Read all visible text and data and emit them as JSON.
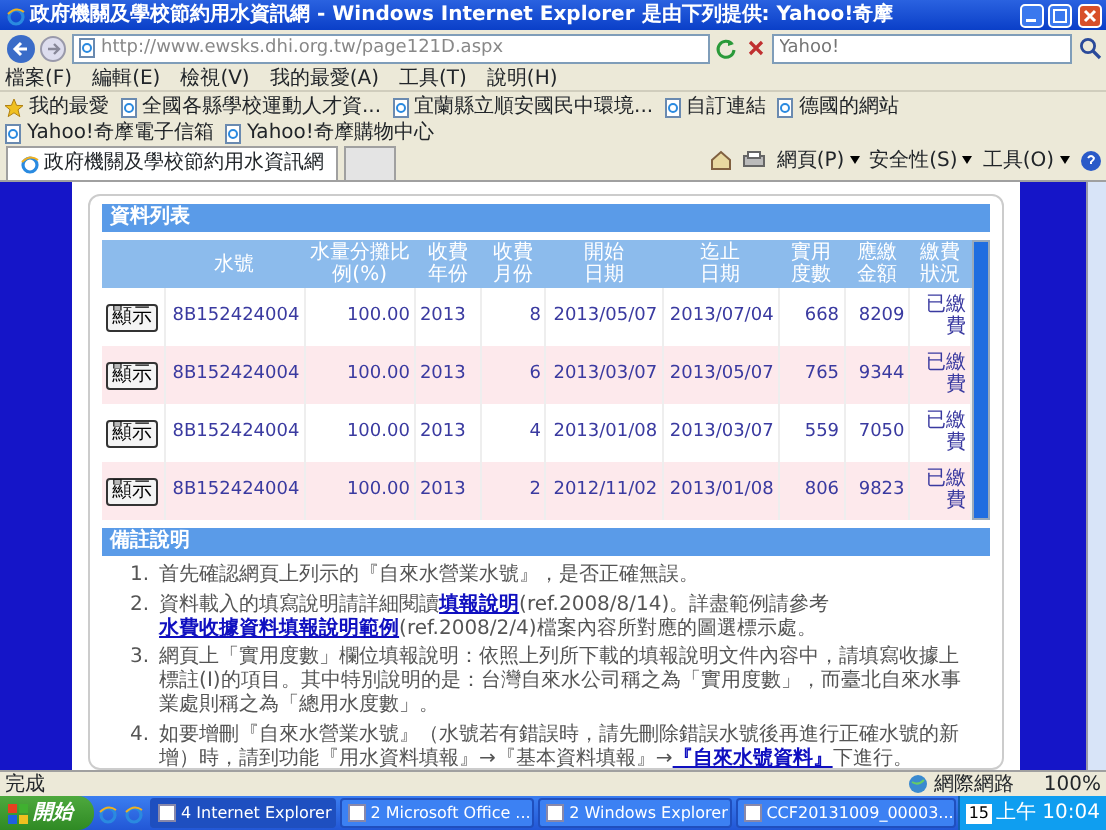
{
  "window": {
    "title": "政府機關及學校節約用水資訊網 - Windows Internet Explorer 是由下列提供: Yahoo!奇摩"
  },
  "address_bar": {
    "url": "http://www.ewsks.dhi.org.tw/page121D.aspx",
    "search_placeholder": "Yahoo!"
  },
  "menu": [
    "檔案(F)",
    "編輯(E)",
    "檢視(V)",
    "我的最愛(A)",
    "工具(T)",
    "說明(H)"
  ],
  "favorites_bar": {
    "label": "我的最愛",
    "links": [
      "全國各縣學校運動人才資...",
      "宜蘭縣立順安國民中環境...",
      "自訂連結",
      "德國的網站",
      "Yahoo!奇摩電子信箱",
      "Yahoo!奇摩購物中心"
    ]
  },
  "tabs": [
    {
      "label": "政府機關及學校節約用水資訊網",
      "selected": true
    }
  ],
  "command_bar": [
    "網頁(P)",
    "安全性(S)",
    "工具(O)"
  ],
  "data_list": {
    "title": "資料列表",
    "columns": [
      "",
      "水號",
      "水量分攤比例(%)",
      "收費年份",
      "收費月份",
      "開始日期",
      "迄止日期",
      "實用度數",
      "應繳金額",
      "繳費狀況"
    ],
    "rows": [
      {
        "cells": [
          "顯示",
          "8B152424004",
          "100.00",
          "2013",
          "8",
          "2013/05/07",
          "2013/07/04",
          "668",
          "8209",
          "已繳費"
        ]
      },
      {
        "cells": [
          "顯示",
          "8B152424004",
          "100.00",
          "2013",
          "6",
          "2013/03/07",
          "2013/05/07",
          "765",
          "9344",
          "已繳費"
        ]
      },
      {
        "cells": [
          "顯示",
          "8B152424004",
          "100.00",
          "2013",
          "4",
          "2013/01/08",
          "2013/03/07",
          "559",
          "7050",
          "已繳費"
        ]
      },
      {
        "cells": [
          "顯示",
          "8B152424004",
          "100.00",
          "2013",
          "2",
          "2012/11/02",
          "2013/01/08",
          "806",
          "9823",
          "已繳費"
        ]
      }
    ]
  },
  "remarks": {
    "title": "備註說明",
    "items": [
      {
        "number": "1.",
        "parts": [
          {
            "kind": "text",
            "text": "首先確認網頁上列示的『自來水營業水號』，是否正確無誤。"
          }
        ]
      },
      {
        "number": "2.",
        "parts": [
          {
            "kind": "text",
            "text": "資料載入的填寫說明請詳細閱讀"
          },
          {
            "kind": "link",
            "text": "填報說明"
          },
          {
            "kind": "text",
            "text": "(ref.2008/8/14)。詳盡範例請參考"
          },
          {
            "kind": "link",
            "text": "水費收據資料填報說明範例"
          },
          {
            "kind": "text",
            "text": "(ref.2008/2/4)檔案內容所對應的圖選標示處。"
          }
        ]
      },
      {
        "number": "3.",
        "parts": [
          {
            "kind": "text",
            "text": "網頁上「實用度數」欄位填報說明：依照上列所下載的填報說明文件內容中，請填寫收據上標註(I)的項目。其中特別說明的是：台灣自來水公司稱之為「實用度數」，而臺北自來水事業處則稱之為「總用水度數」。"
          }
        ]
      },
      {
        "number": "4.",
        "parts": [
          {
            "kind": "text",
            "text": "如要增刪『自來水營業水號』（水號若有錯誤時，請先刪除錯誤水號後再進行正確水號的新增）時，請到功能『用水資料填報』→『基本資料填報』→"
          },
          {
            "kind": "link",
            "text": "『自來水號資料』"
          },
          {
            "kind": "text",
            "text": "下進行。"
          }
        ]
      }
    ]
  },
  "status_bar": {
    "text": "完成",
    "zone": "網際網路",
    "zoom": "100%"
  },
  "taskbar": {
    "start": "開始",
    "tasks": [
      "4 Internet Explorer",
      "2 Microsoft Office ...",
      "2 Windows Explorer",
      "CCF20131009_00003..."
    ],
    "tray_date": "15",
    "clock": "上午 10:04"
  }
}
